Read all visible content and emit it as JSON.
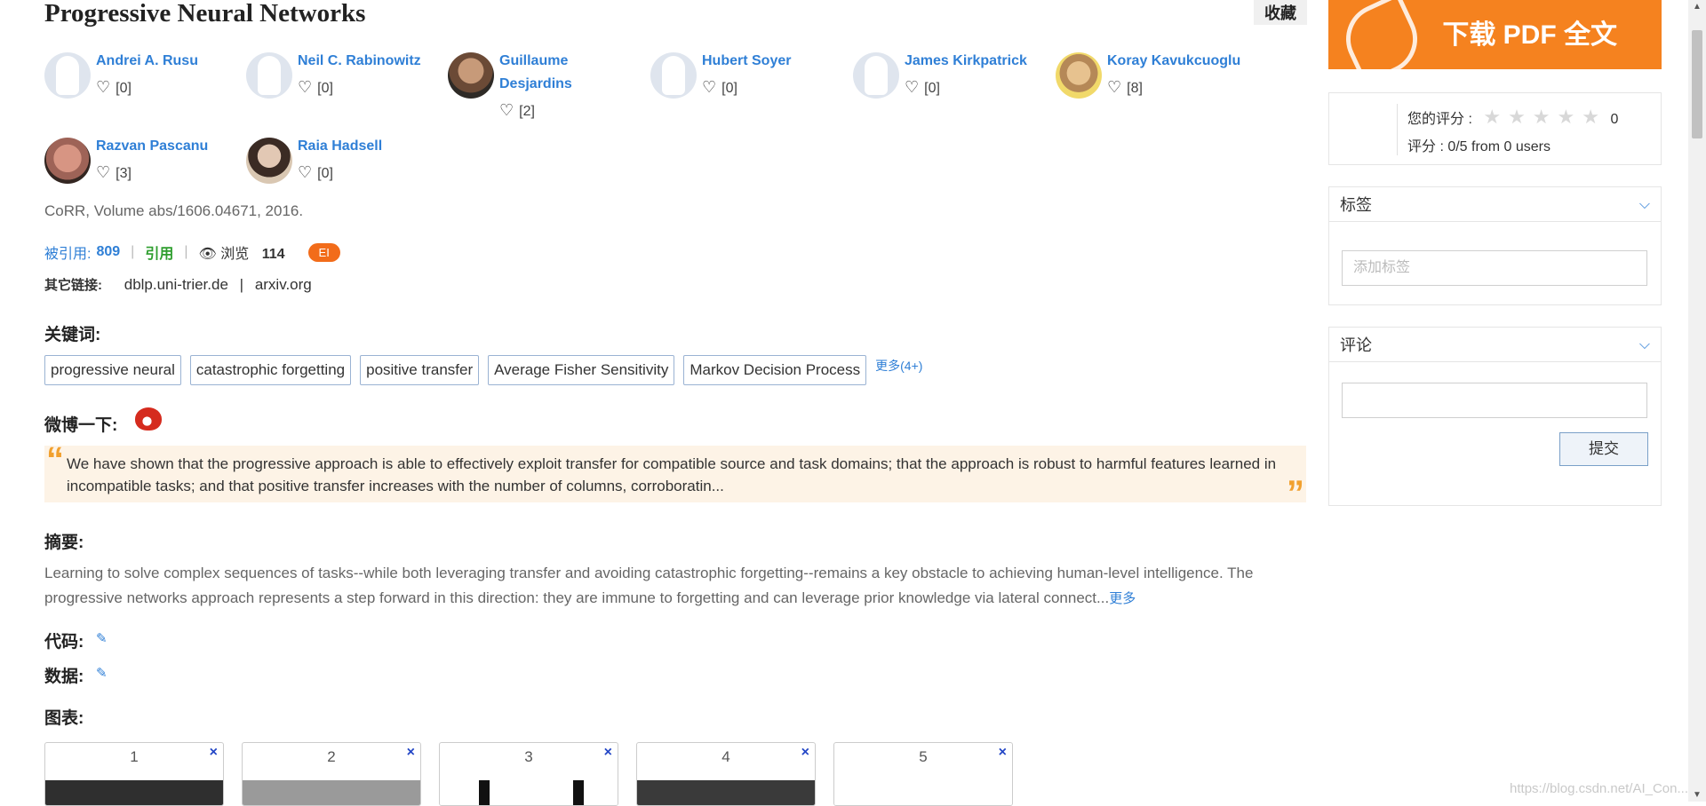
{
  "paper": {
    "title": "Progressive Neural Networks",
    "fav_label": "收藏",
    "venue": "CoRR, Volume abs/1606.04671, 2016.",
    "cited_label": "被引用:",
    "cited_count": "809",
    "cite_label": "引用",
    "views_label": "浏览",
    "views_count": "114",
    "ei_badge": "EI",
    "other_links_label": "其它链接:",
    "links": [
      "dblp.uni-trier.de",
      "arxiv.org"
    ],
    "link_sep": "|"
  },
  "authors": [
    {
      "name": "Andrei A. Rusu",
      "likes": "[0]",
      "avatar": "placeholder"
    },
    {
      "name": "Neil C. Rabinowitz",
      "likes": "[0]",
      "avatar": "placeholder"
    },
    {
      "name": "Guillaume Desjardins",
      "likes": "[2]",
      "avatar": "photo"
    },
    {
      "name": "Hubert Soyer",
      "likes": "[0]",
      "avatar": "placeholder"
    },
    {
      "name": "James Kirkpatrick",
      "likes": "[0]",
      "avatar": "placeholder"
    },
    {
      "name": "Koray Kavukcuoglu",
      "likes": "[8]",
      "avatar": "photo"
    },
    {
      "name": "Razvan Pascanu",
      "likes": "[3]",
      "avatar": "photo"
    },
    {
      "name": "Raia Hadsell",
      "likes": "[0]",
      "avatar": "photo"
    }
  ],
  "keywords_section": {
    "label": "关键词:",
    "items": [
      "progressive neural",
      "catastrophic forgetting",
      "positive transfer",
      "Average Fisher Sensitivity",
      "Markov Decision Process"
    ],
    "more": "更多(4+)"
  },
  "weibo": {
    "label": "微博一下:",
    "icon": "weibo-icon"
  },
  "quote": {
    "open_mark": "“",
    "close_mark": "”",
    "text": "We have shown that the progressive approach is able to effectively exploit transfer for compatible source and task domains; that the approach is robust to harmful features learned in incompatible tasks; and that positive transfer increases with the number of columns, corroboratin..."
  },
  "abstract": {
    "label": "摘要:",
    "text": "Learning to solve complex sequences of tasks--while both leveraging transfer and avoiding catastrophic forgetting--remains a key obstacle to achieving human-level intelligence. The progressive networks approach represents a step forward in this direction: they are immune to forgetting and can leverage prior knowledge via lateral connect...",
    "more": "更多"
  },
  "code": {
    "label": "代码:",
    "icon": "edit-icon"
  },
  "data_section": {
    "label": "数据:",
    "icon": "edit-icon"
  },
  "figures": {
    "label": "图表:",
    "items": [
      "1",
      "2",
      "3",
      "4",
      "5"
    ],
    "close": "×"
  },
  "sidebar": {
    "pdf_button": "下载 PDF 全文",
    "your_rating_label": "您的评分 :",
    "stars": "★★★★★",
    "your_rating_value": "0",
    "rating_summary": "评分 : 0/5 from 0 users",
    "tags_title": "标签",
    "tags_placeholder": "添加标签",
    "comments_title": "评论",
    "submit_label": "提交",
    "chevron": "⌵"
  },
  "watermark": "https://blog.csdn.net/AI_Con..."
}
